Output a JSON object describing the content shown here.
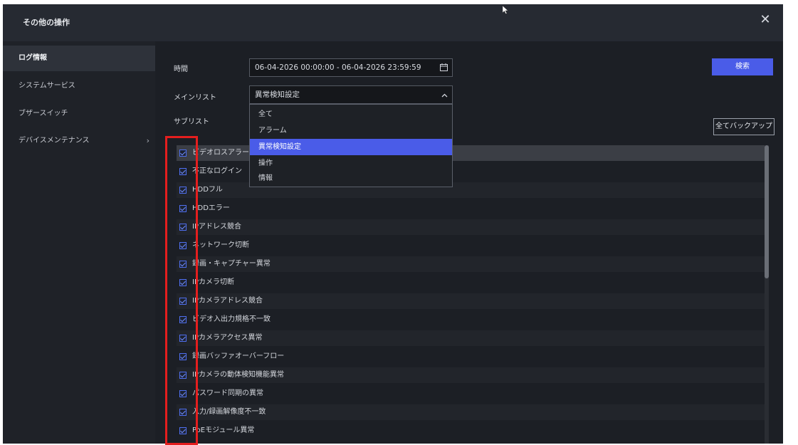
{
  "window": {
    "title": "その他の操作",
    "close_label": "✕"
  },
  "sidebar": {
    "items": [
      {
        "label": "ログ情報",
        "active": true
      },
      {
        "label": "システムサービス"
      },
      {
        "label": "ブザースイッチ"
      },
      {
        "label": "デバイスメンテナンス",
        "chevron": "›"
      }
    ]
  },
  "filters": {
    "time_label": "時間",
    "time_value": "06-04-2026 00:00:00 - 06-04-2026 23:59:59",
    "main_list_label": "メインリスト",
    "main_list_value": "異常検知設定",
    "sub_list_label": "サブリスト",
    "search_button": "検索",
    "backup_button": "全てバックアップ",
    "calendar_icon": "calendar-icon",
    "chevron_icon": "chevron-up-icon"
  },
  "dropdown_options": [
    {
      "label": "全て"
    },
    {
      "label": "アラーム"
    },
    {
      "label": "異常検知設定",
      "selected": true
    },
    {
      "label": "操作"
    },
    {
      "label": "情報"
    }
  ],
  "sub_items": [
    "ビデオロスアラーム",
    "不正なログイン",
    "HDDフル",
    "HDDエラー",
    "IPアドレス競合",
    "ネットワーク切断",
    "録画・キャプチャー異常",
    "IPカメラ切断",
    "IPカメラアドレス競合",
    "ビデオ入出力規格不一致",
    "IPカメラアクセス異常",
    "録画バッファオーバーフロー",
    "IPカメラの動体検知機能異常",
    "パスワード同期の異常",
    "入力/録画解像度不一致",
    "PoEモジュール異常"
  ],
  "colors": {
    "accent": "#4a5ce8",
    "annotation": "#e41e1e",
    "background": "#1c1f25"
  }
}
